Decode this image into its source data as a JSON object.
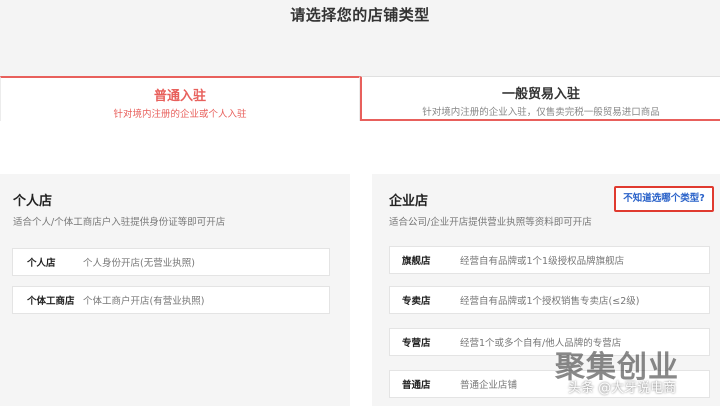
{
  "page": {
    "title": "请选择您的店铺类型"
  },
  "tabs": [
    {
      "title": "普通入驻",
      "subtitle": "针对境内注册的企业或个人入驻"
    },
    {
      "title": "一般贸易入驻",
      "subtitle": "针对境内注册的企业入驻，仅售卖完税一般贸易进口商品"
    }
  ],
  "personal": {
    "title": "个人店",
    "desc": "适合个人/个体工商店户入驻提供身份证等即可开店",
    "options": [
      {
        "label": "个人店",
        "desc": "个人身份开店(无营业执照)"
      },
      {
        "label": "个体工商店",
        "desc": "个体工商户开店(有营业执照)"
      }
    ]
  },
  "enterprise": {
    "title": "企业店",
    "desc": "适合公司/企业开店提供营业执照等资料即可开店",
    "help_link": "不知道选哪个类型?",
    "options": [
      {
        "label": "旗舰店",
        "desc": "经营自有品牌或1个1级授权品牌旗舰店"
      },
      {
        "label": "专卖店",
        "desc": "经营自有品牌或1个授权销售专卖店(≤2级)"
      },
      {
        "label": "专营店",
        "desc": "经营1个或多个自有/他人品牌的专营店"
      },
      {
        "label": "普通店",
        "desc": "普通企业店铺"
      }
    ]
  },
  "watermark": {
    "big": "聚集创业",
    "small": "头条 @大牙说电商"
  },
  "colors": {
    "accent": "#e8605c",
    "link": "#2a62c9",
    "highlight_box": "#e03a2f"
  }
}
